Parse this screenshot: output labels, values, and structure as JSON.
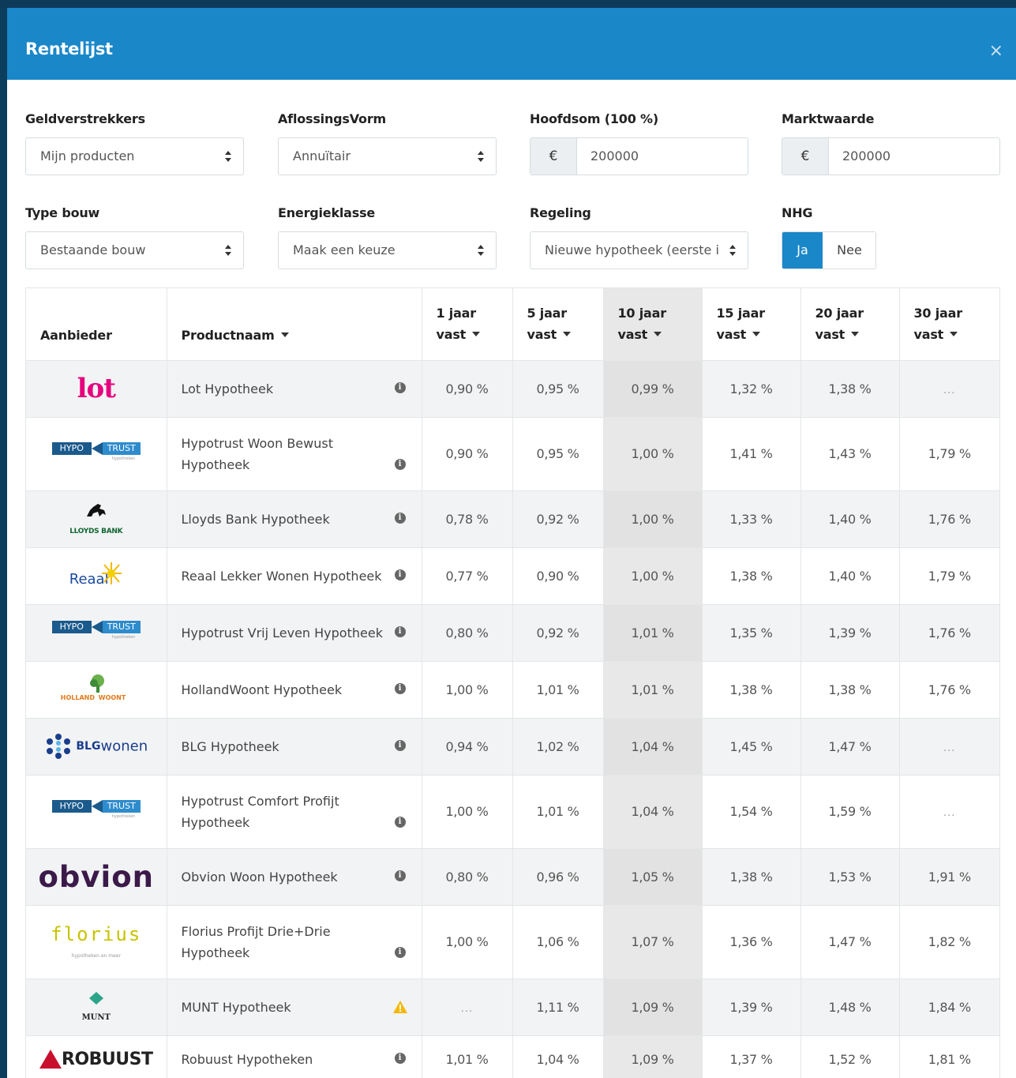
{
  "modal": {
    "title": "Rentelijst",
    "close": "×"
  },
  "filters": {
    "geldverstrekkers": {
      "label": "Geldverstrekkers",
      "value": "Mijn producten"
    },
    "aflossingsvorm": {
      "label": "AflossingsVorm",
      "value": "Annuïtair"
    },
    "hoofdsom": {
      "label": "Hoofdsom (100 %)",
      "currency": "€",
      "value": "200000"
    },
    "marktwaarde": {
      "label": "Marktwaarde",
      "currency": "€",
      "value": "200000"
    },
    "type_bouw": {
      "label": "Type bouw",
      "value": "Bestaande bouw"
    },
    "energieklasse": {
      "label": "Energieklasse",
      "value": "Maak een keuze"
    },
    "regeling": {
      "label": "Regeling",
      "value": "Nieuwe hypotheek (eerste i"
    },
    "nhg": {
      "label": "NHG",
      "yes": "Ja",
      "no": "Nee",
      "selected": "Ja"
    }
  },
  "table": {
    "headers": {
      "aanbieder": "Aanbieder",
      "productnaam": "Productnaam",
      "y1a": "1 jaar",
      "y1b": "vast",
      "y5a": "5 jaar",
      "y5b": "vast",
      "y10a": "10 jaar",
      "y10b": "vast",
      "y15a": "15 jaar",
      "y15b": "vast",
      "y20a": "20 jaar",
      "y20b": "vast",
      "y30a": "30 jaar",
      "y30b": "vast"
    },
    "rows": [
      {
        "logo": "lot",
        "product": "Lot Hypotheek",
        "icon": "info",
        "r1": "0,90 %",
        "r5": "0,95 %",
        "r10": "0,99 %",
        "r15": "1,32 %",
        "r20": "1,38 %",
        "r30": "..."
      },
      {
        "logo": "hypotrust",
        "product": "Hypotrust Woon Bewust Hypotheek",
        "icon": "info",
        "r1": "0,90 %",
        "r5": "0,95 %",
        "r10": "1,00 %",
        "r15": "1,41 %",
        "r20": "1,43 %",
        "r30": "1,79 %"
      },
      {
        "logo": "lloyds",
        "product": "Lloyds Bank Hypotheek",
        "icon": "info",
        "r1": "0,78 %",
        "r5": "0,92 %",
        "r10": "1,00 %",
        "r15": "1,33 %",
        "r20": "1,40 %",
        "r30": "1,76 %"
      },
      {
        "logo": "reaal",
        "product": "Reaal Lekker Wonen Hypotheek",
        "icon": "info",
        "r1": "0,77 %",
        "r5": "0,90 %",
        "r10": "1,00 %",
        "r15": "1,38 %",
        "r20": "1,40 %",
        "r30": "1,79 %"
      },
      {
        "logo": "hypotrust",
        "product": "Hypotrust Vrij Leven Hypotheek",
        "icon": "info",
        "r1": "0,80 %",
        "r5": "0,92 %",
        "r10": "1,01 %",
        "r15": "1,35 %",
        "r20": "1,39 %",
        "r30": "1,76 %"
      },
      {
        "logo": "hollandwoont",
        "product": "HollandWoont Hypotheek",
        "icon": "info",
        "r1": "1,00 %",
        "r5": "1,01 %",
        "r10": "1,01 %",
        "r15": "1,38 %",
        "r20": "1,38 %",
        "r30": "1,76 %"
      },
      {
        "logo": "blg",
        "product": "BLG Hypotheek",
        "icon": "info",
        "r1": "0,94 %",
        "r5": "1,02 %",
        "r10": "1,04 %",
        "r15": "1,45 %",
        "r20": "1,47 %",
        "r30": "..."
      },
      {
        "logo": "hypotrust",
        "product": "Hypotrust Comfort Profijt Hypotheek",
        "icon": "info",
        "r1": "1,00 %",
        "r5": "1,01 %",
        "r10": "1,04 %",
        "r15": "1,54 %",
        "r20": "1,59 %",
        "r30": "..."
      },
      {
        "logo": "obvion",
        "product": "Obvion Woon Hypotheek",
        "icon": "info",
        "r1": "0,80 %",
        "r5": "0,96 %",
        "r10": "1,05 %",
        "r15": "1,38 %",
        "r20": "1,53 %",
        "r30": "1,91 %"
      },
      {
        "logo": "florius",
        "product": "Florius Profijt Drie+Drie Hypotheek",
        "icon": "info",
        "r1": "1,00 %",
        "r5": "1,06 %",
        "r10": "1,07 %",
        "r15": "1,36 %",
        "r20": "1,47 %",
        "r30": "1,82 %"
      },
      {
        "logo": "munt",
        "product": "MUNT Hypotheek",
        "icon": "warning",
        "r1": "...",
        "r5": "1,11 %",
        "r10": "1,09 %",
        "r15": "1,39 %",
        "r20": "1,48 %",
        "r30": "1,84 %"
      },
      {
        "logo": "robuust",
        "product": "Robuust Hypotheken",
        "icon": "info",
        "r1": "1,01 %",
        "r5": "1,04 %",
        "r10": "1,09 %",
        "r15": "1,37 %",
        "r20": "1,52 %",
        "r30": "1,81 %"
      }
    ]
  },
  "logos": {
    "lot": "lot",
    "hypo": "HYPO",
    "trust": "TRUST",
    "hypotheken": "hypotheken",
    "lloyds": "LLOYDS BANK",
    "reaal": "Reaal",
    "holland": "HOLLAND",
    "woont": "WOONT",
    "blg_a": "BLG",
    "blg_b": "wonen",
    "obvion": "obvion",
    "florius": "florius",
    "florius_sub": "hypotheken en meer",
    "munt": "MUNT",
    "robuust": "ROBUUST"
  },
  "colors": {
    "header_blue": "#1a87c9",
    "lot_pink": "#e6007e",
    "obvion_purple": "#3b1a4a",
    "florius_yellow": "#c8c400",
    "hypotrust_blue": "#1b5a8c",
    "blg_blue": "#1a3e8c"
  }
}
